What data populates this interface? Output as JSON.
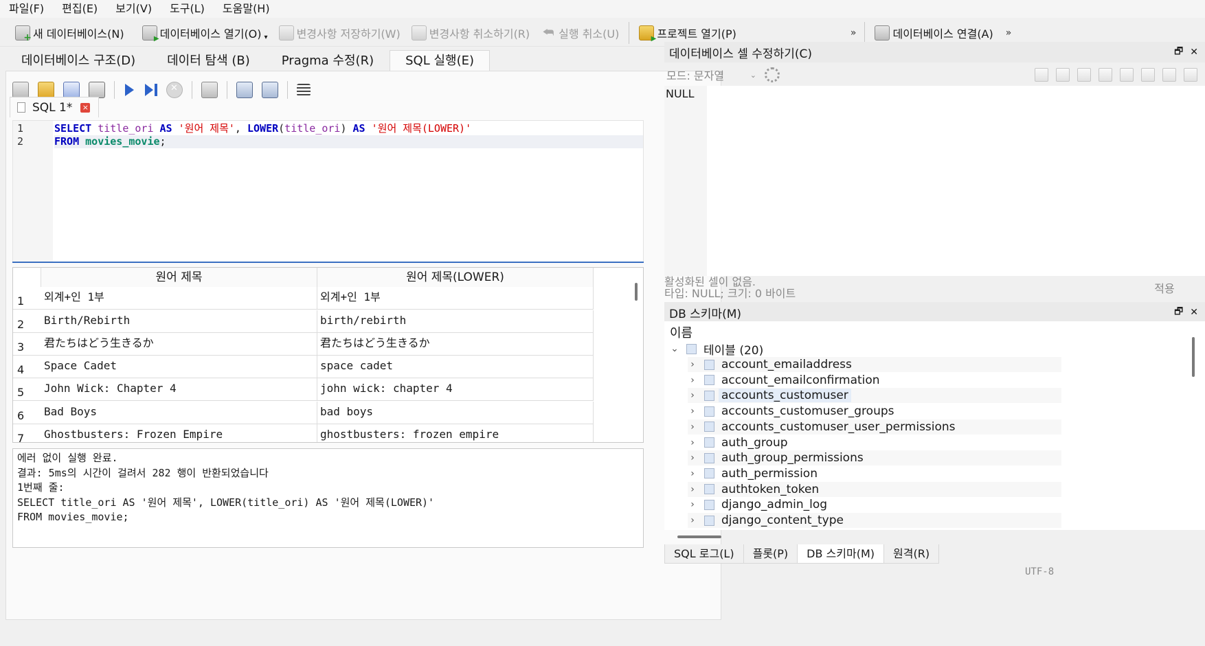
{
  "menu": [
    "파일(F)",
    "편집(E)",
    "보기(V)",
    "도구(L)",
    "도움말(H)"
  ],
  "toolbar": {
    "new_db": "새 데이터베이스(N)",
    "open_db": "데이터베이스 열기(O)",
    "write_changes": "변경사항 저장하기(W)",
    "revert_changes": "변경사항 취소하기(R)",
    "undo": "실행 취소(U)",
    "open_project": "프로젝트 열기(P)",
    "more": "»",
    "attach_db": "데이터베이스 연결(A)",
    "more2": "»"
  },
  "main_tabs": [
    "데이터베이스 구조(D)",
    "데이터 탐색 (B)",
    "Pragma 수정(R)",
    "SQL 실행(E)"
  ],
  "sql_tab": {
    "label": "SQL 1*",
    "close": "×"
  },
  "editor": {
    "line_numbers": [
      "1",
      "2"
    ],
    "line1": {
      "kw1": "SELECT",
      "col1": "title_ori",
      "kw2": "AS",
      "str1": "'원어 제목'",
      "sep": ",",
      "fn": "LOWER",
      "paren_open": "(",
      "col2": "title_ori",
      "paren_close": ")",
      "kw3": "AS",
      "str2": "'원어 제목(LOWER)'"
    },
    "line2": {
      "kw": "FROM",
      "table": "movies_movie",
      "end": ";"
    }
  },
  "results": {
    "headers": [
      "원어 제목",
      "원어 제목(LOWER)"
    ],
    "rows": [
      {
        "n": "1",
        "a": "외계+인 1부",
        "b": "외계+인 1부"
      },
      {
        "n": "2",
        "a": "Birth/Rebirth",
        "b": "birth/rebirth"
      },
      {
        "n": "3",
        "a": "君たちはどう生きるか",
        "b": "君たちはどう生きるか"
      },
      {
        "n": "4",
        "a": "Space Cadet",
        "b": "space cadet"
      },
      {
        "n": "5",
        "a": "John Wick: Chapter 4",
        "b": "john wick: chapter 4"
      },
      {
        "n": "6",
        "a": "Bad Boys",
        "b": "bad boys"
      },
      {
        "n": "7",
        "a": "Ghostbusters: Frozen Empire",
        "b": "ghostbusters: frozen empire"
      }
    ]
  },
  "message": [
    "에러 없이 실행 완료.",
    "결과: 5ms의 시간이 걸려서 282 행이 반환되었습니다",
    "1번째 줄:",
    "SELECT title_ori AS '원어 제목', LOWER(title_ori) AS '원어 제목(LOWER)'",
    "FROM movies_movie;"
  ],
  "cell_panel": {
    "title": "데이터베이스 셀 수정하기(C)",
    "mode": "모드: 문자열",
    "value": "NULL",
    "status1": "활성화된 셀이 없음.",
    "status2": "타입: NULL; 크기: 0 바이트",
    "apply": "적용"
  },
  "schema_panel": {
    "title": "DB 스키마(M)",
    "col_name": "이름",
    "tables_node": "테이블 (20)",
    "tables": [
      "account_emailaddress",
      "account_emailconfirmation",
      "accounts_customuser",
      "accounts_customuser_groups",
      "accounts_customuser_user_permissions",
      "auth_group",
      "auth_group_permissions",
      "auth_permission",
      "authtoken_token",
      "django_admin_log",
      "django_content_type"
    ]
  },
  "bottom_tabs": [
    "SQL 로그(L)",
    "플롯(P)",
    "DB 스키마(M)",
    "원격(R)"
  ],
  "status": {
    "encoding": "UTF-8"
  }
}
